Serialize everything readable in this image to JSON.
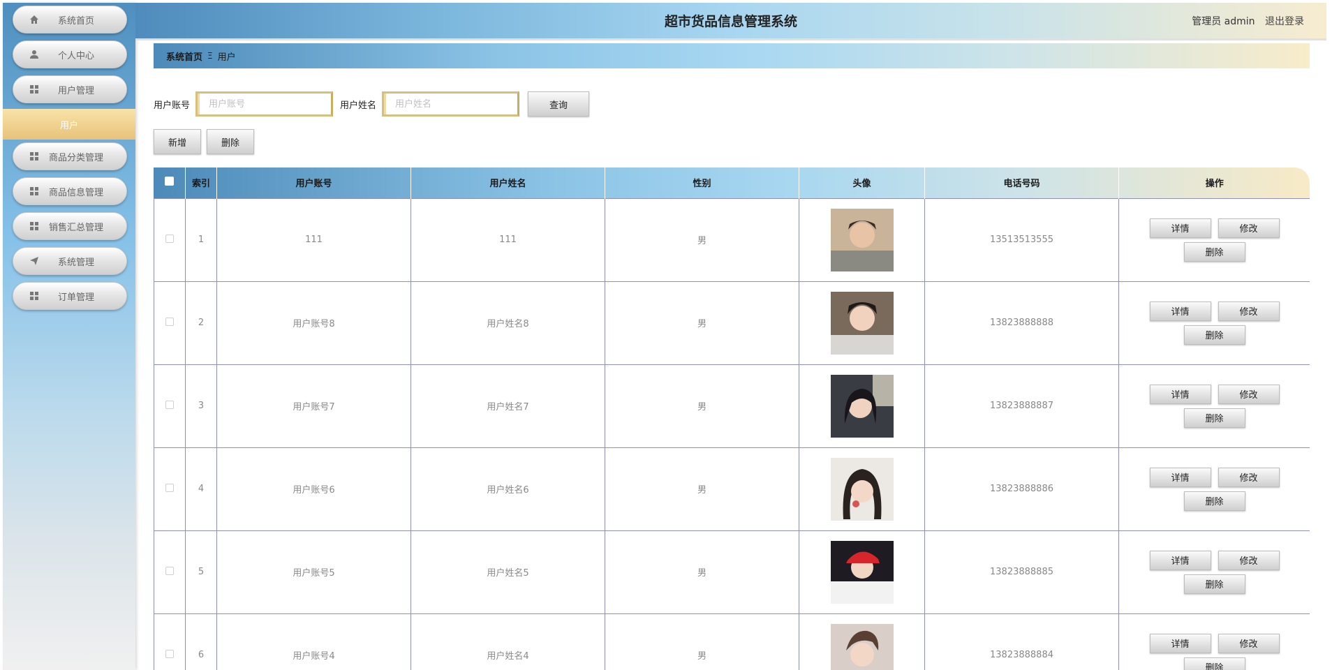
{
  "sidebar": {
    "items": [
      {
        "label": "系统首页",
        "icon": "home-icon"
      },
      {
        "label": "个人中心",
        "icon": "user-icon"
      },
      {
        "label": "用户管理",
        "icon": "grid-icon"
      },
      {
        "label": "商品分类管理",
        "icon": "grid-icon"
      },
      {
        "label": "商品信息管理",
        "icon": "grid-icon"
      },
      {
        "label": "销售汇总管理",
        "icon": "grid-icon"
      },
      {
        "label": "系统管理",
        "icon": "send-icon"
      },
      {
        "label": "订单管理",
        "icon": "grid-icon"
      }
    ],
    "active_sub": "用户"
  },
  "header": {
    "title": "超市货品信息管理系统",
    "user_label": "管理员 admin",
    "logout": "退出登录"
  },
  "breadcrumb": {
    "home": "系统首页",
    "separator": "Ξ",
    "current": "用户"
  },
  "search": {
    "account_label": "用户账号",
    "account_placeholder": "用户账号",
    "name_label": "用户姓名",
    "name_placeholder": "用户姓名",
    "query_button": "查询"
  },
  "actions": {
    "add": "新增",
    "delete": "删除"
  },
  "table": {
    "headers": [
      "索引",
      "用户账号",
      "用户姓名",
      "性别",
      "头像",
      "电话号码",
      "操作"
    ],
    "rows": [
      {
        "index": "1",
        "account": "111",
        "name": "111",
        "gender": "男",
        "phone": "13513513555"
      },
      {
        "index": "2",
        "account": "用户账号8",
        "name": "用户姓名8",
        "gender": "男",
        "phone": "13823888888"
      },
      {
        "index": "3",
        "account": "用户账号7",
        "name": "用户姓名7",
        "gender": "男",
        "phone": "13823888887"
      },
      {
        "index": "4",
        "account": "用户账号6",
        "name": "用户姓名6",
        "gender": "男",
        "phone": "13823888886"
      },
      {
        "index": "5",
        "account": "用户账号5",
        "name": "用户姓名5",
        "gender": "男",
        "phone": "13823888885"
      },
      {
        "index": "6",
        "account": "用户账号4",
        "name": "用户姓名4",
        "gender": "男",
        "phone": "13823888884"
      }
    ],
    "op_labels": {
      "detail": "详情",
      "edit": "修改",
      "delete": "删除"
    }
  },
  "colors": {
    "accent_blue": "#4d8ab9",
    "accent_gold": "#e8c27a",
    "border_purple": "#8d8fc4"
  }
}
